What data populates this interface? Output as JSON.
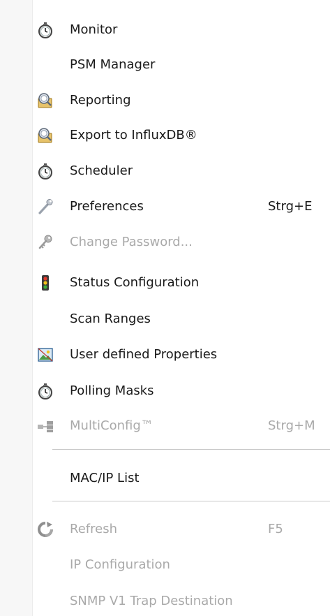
{
  "menu": {
    "items": [
      {
        "label": "Monitor",
        "icon": "stopwatch-icon",
        "disabled": false
      },
      {
        "label": "PSM Manager",
        "icon": "",
        "disabled": false
      },
      {
        "label": "Reporting",
        "icon": "report-icon",
        "disabled": false
      },
      {
        "label": "Export to InfluxDB®",
        "icon": "report-icon",
        "disabled": false
      },
      {
        "label": "Scheduler",
        "icon": "stopwatch-icon",
        "disabled": false
      },
      {
        "label": "Preferences",
        "shortcut": "Strg+E",
        "icon": "wrench-icon",
        "disabled": false
      },
      {
        "label": "Change Password...",
        "icon": "key-icon",
        "disabled": true
      },
      {
        "label": "Status Configuration",
        "icon": "traffic-light-icon",
        "disabled": false
      },
      {
        "label": "Scan Ranges",
        "icon": "",
        "disabled": false
      },
      {
        "label": "User defined Properties",
        "icon": "properties-image-icon",
        "disabled": false
      },
      {
        "label": "Polling Masks",
        "icon": "stopwatch-icon",
        "disabled": false
      },
      {
        "label": "MultiConfig™",
        "shortcut": "Strg+M",
        "icon": "multiconfig-icon",
        "disabled": true
      },
      {
        "label": "MAC/IP List",
        "icon": "",
        "disabled": false
      },
      {
        "label": "Refresh",
        "shortcut": "F5",
        "icon": "refresh-icon",
        "disabled": true
      },
      {
        "label": "IP Configuration",
        "icon": "",
        "disabled": true
      },
      {
        "label": "SNMP V1 Trap Destination",
        "icon": "",
        "disabled": true
      }
    ]
  },
  "colors": {
    "text": "#1a1a1a",
    "disabled_text": "#a9a9a9",
    "separator": "#c9c9c9"
  }
}
